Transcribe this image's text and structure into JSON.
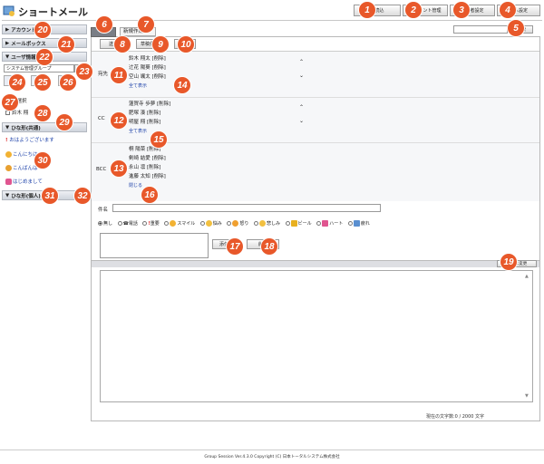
{
  "app": {
    "title": "ショートメール"
  },
  "toolbar": {
    "reload_label": "再読込",
    "account_label": "アカウント管理",
    "personal_label": "個人設定",
    "admin_label": "管理者設定"
  },
  "search": {
    "button_label": "検索",
    "placeholder": ""
  },
  "sidebar": {
    "account_label": "アカウント",
    "mailbox_label": "メールボックス",
    "userinfo_label": "ユーザ情報",
    "group_select": "システム管理グループ",
    "all_select_label": "全選択",
    "user_name": "鈴木 翔",
    "hina_common_label": "ひな形(共通)",
    "hina_items": [
      "おはようございます",
      "こんにちは",
      "こんばんは",
      "はじめまして"
    ],
    "hina_personal_label": "ひな形(個人)"
  },
  "tabs": {
    "new_mail": "新規作成"
  },
  "buttons": {
    "send": "送信",
    "draft": "草稿保存",
    "back": "戻る",
    "attach": "添付",
    "delete": "削除"
  },
  "recipients": {
    "to_label": "宛先",
    "to_list": [
      "鈴木 翔太 [削除]",
      "辻花 陽葵 [削除]",
      "空山 颯太 [削除]"
    ],
    "cc_label": "CC",
    "cc_list": [
      "蓮賀寺 歩夢 [削除]",
      "肥塚 湊 [削除]",
      "明屋 翔 [削除]"
    ],
    "bcc_label": "BCC",
    "bcc_list": [
      "桐 陽菜 [削除]",
      "剣崎 結愛 [削除]",
      "永山 凛 [削除]",
      "進藤 太知 [削除]"
    ],
    "show_all": "全て表示",
    "close": "閉じる"
  },
  "subject": {
    "label": "件名",
    "value": ""
  },
  "marks": [
    "無し",
    "電話",
    "重要",
    "スマイル",
    "悩み",
    "怒り",
    "悲しみ",
    "ビール",
    "ハート",
    "疲れ"
  ],
  "body": {
    "change_btn": "本文に変更",
    "counter": "現在の文字数:0 / 2000 文字"
  },
  "footer": {
    "copyright": "Group Session Ver.4.3.0 Copyright (C) 日本トータルシステム株式会社"
  },
  "badges": [
    "1",
    "2",
    "3",
    "4",
    "5",
    "6",
    "7",
    "8",
    "9",
    "10",
    "11",
    "12",
    "13",
    "14",
    "15",
    "16",
    "17",
    "18",
    "19",
    "20",
    "21",
    "22",
    "23",
    "24",
    "25",
    "26",
    "27",
    "28",
    "29",
    "30",
    "31",
    "32"
  ],
  "colors": {
    "accent": "#e8582a",
    "link": "#1a3fa8"
  }
}
